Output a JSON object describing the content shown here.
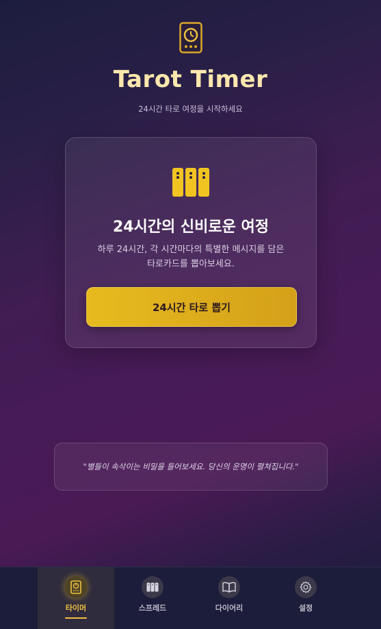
{
  "header": {
    "title": "Tarot Timer",
    "subtitle": "24시간 타로 여정을 시작하세요",
    "icon": "tarot-clock-icon"
  },
  "card": {
    "icon": "tarot-cards-icon",
    "title": "24시간의 신비로운 여정",
    "description_line1": "하루 24시간, 각 시간마다의 특별한 메시지를 담은",
    "description_line2": "타로카드를 뽑아보세요.",
    "button_label": "24시간 타로 뽑기"
  },
  "quote": {
    "text": "\"별들이 속삭이는 비밀을 들어보세요. 당신의 운명이 펼쳐집니다.\""
  },
  "bottom_nav": {
    "items": [
      {
        "label": "타이머",
        "icon": "timer-card-icon",
        "active": true
      },
      {
        "label": "스프레드",
        "icon": "spread-cards-icon",
        "active": false
      },
      {
        "label": "다이어리",
        "icon": "book-icon",
        "active": false
      },
      {
        "label": "설정",
        "icon": "gear-icon",
        "active": false
      }
    ]
  },
  "colors": {
    "accent": "#f0c040",
    "title": "#fde7ad",
    "button": "#e0b01d",
    "background_dark": "#1c1d3e",
    "background_purple": "#461b56"
  }
}
